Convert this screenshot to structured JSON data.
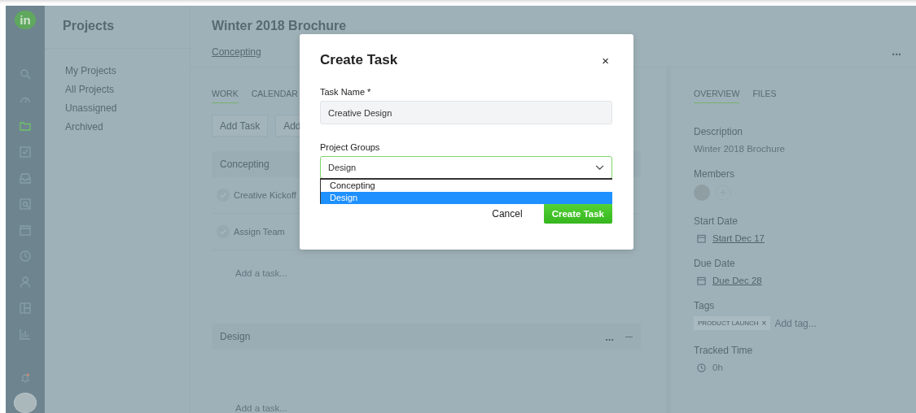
{
  "logo": "in",
  "nav": [
    {
      "kind": "search",
      "selected": false
    },
    {
      "kind": "gauge",
      "selected": false
    },
    {
      "kind": "folder",
      "selected": true
    },
    {
      "kind": "check",
      "selected": false
    },
    {
      "kind": "inbox",
      "selected": false
    },
    {
      "kind": "review",
      "selected": false
    },
    {
      "kind": "calendar",
      "selected": false
    },
    {
      "kind": "clock",
      "selected": false
    },
    {
      "kind": "person",
      "selected": false
    },
    {
      "kind": "layout",
      "selected": false
    },
    {
      "kind": "chart",
      "selected": false
    }
  ],
  "projects": {
    "title": "Projects",
    "items": [
      "My Projects",
      "All Projects",
      "Unassigned",
      "Archived"
    ]
  },
  "project": {
    "title": "Winter 2018 Brochure",
    "breadcrumb": "Concepting",
    "more": "...",
    "tabs": [
      {
        "label": "WORK",
        "selected": true
      },
      {
        "label": "CALENDAR",
        "selected": false
      }
    ],
    "buttons": [
      "Add Task",
      "Add"
    ],
    "groups": [
      {
        "name": "Concepting",
        "tasks": [
          "Creative Kickoff",
          "Assign Team"
        ],
        "add_placeholder": "Add a task..."
      },
      {
        "name": "Design",
        "menu": "...",
        "add_placeholder": "Add a task..."
      }
    ]
  },
  "details": {
    "tabs": [
      {
        "label": "OVERVIEW",
        "selected": true
      },
      {
        "label": "FILES",
        "selected": false
      }
    ],
    "description_label": "Description",
    "description": "Winter 2018 Brochure",
    "members_label": "Members",
    "start_label": "Start Date",
    "start": "Start Dec 17",
    "due_label": "Due Date",
    "due": "Due Dec 28",
    "tags_label": "Tags",
    "tags": [
      {
        "label": "PRODUCT LAUNCH",
        "remove": "×"
      }
    ],
    "tag_placeholder": "Add tag...",
    "tracked_label": "Tracked Time",
    "tracked": "0h"
  },
  "modal": {
    "title": "Create Task",
    "close": "×",
    "name_label": "Task Name *",
    "name_value": "Creative Design",
    "group_label": "Project Groups",
    "group_value": "Design",
    "options": [
      {
        "label": "Concepting",
        "selected": false
      },
      {
        "label": "Design",
        "selected": true
      }
    ],
    "cancel": "Cancel",
    "submit": "Create Task"
  }
}
